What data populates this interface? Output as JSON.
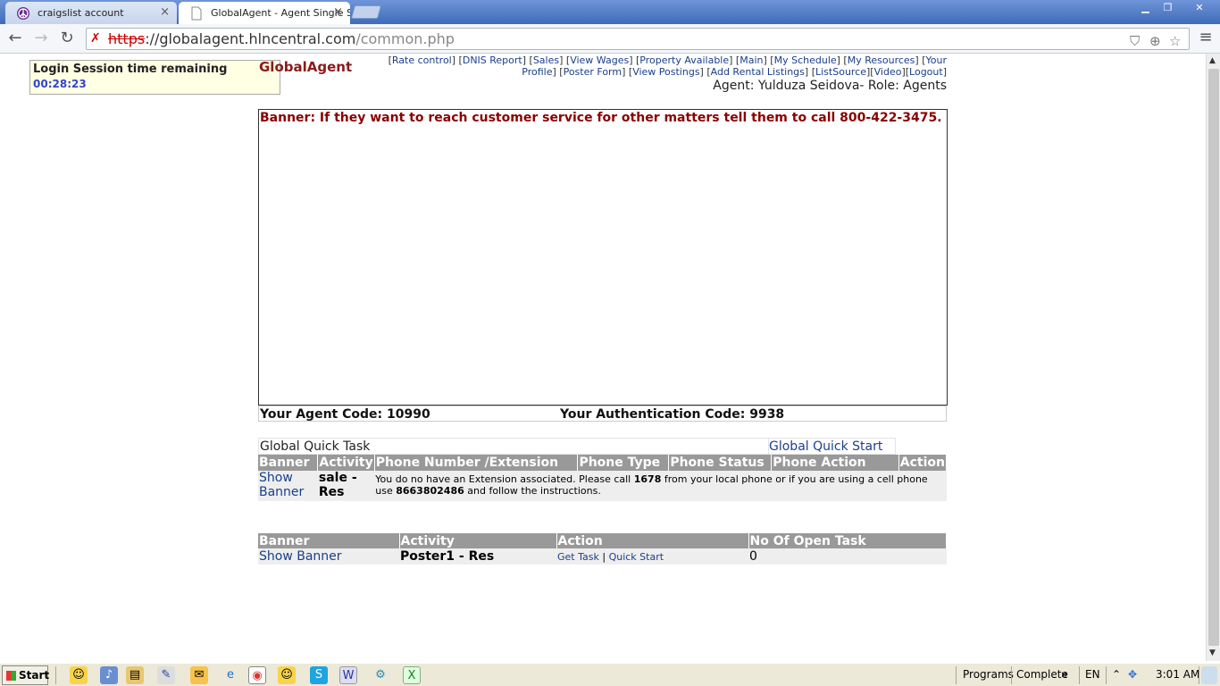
{
  "browser": {
    "tabs": [
      {
        "title": "craigslist account",
        "active": false
      },
      {
        "title": "GlobalAgent - Agent Single S",
        "active": true
      }
    ],
    "address": {
      "scheme": "https",
      "host": "://globalagent.hlncentral.com",
      "path": "/common.php"
    }
  },
  "session": {
    "label": "Login Session time remaining",
    "time": "00:28:23"
  },
  "header": {
    "logo": "GlobalAgent",
    "nav_line1": [
      "Rate control",
      "DNIS Report",
      "Sales",
      "View Wages",
      "Property Available",
      "Main",
      "My Schedule",
      "My Resources",
      "Your"
    ],
    "nav_line2": [
      "Profile",
      "Poster Form",
      "View Postings",
      "Add Rental Listings",
      "ListSource",
      "Video",
      "Logout"
    ],
    "agent_line": "Agent: Yulduza Seidova- Role: Agents"
  },
  "banner": {
    "text": "Banner: If they want to reach customer service for other matters tell them to call 800-422-3475."
  },
  "codes": {
    "agent_code": "Your Agent Code: 10990",
    "auth_code": "Your Authentication Code: 9938"
  },
  "quick_task": {
    "title": "Global Quick Task",
    "quick_start_link": "Global Quick Start",
    "headers": [
      "Banner",
      "Activity",
      "Phone Number /Extension",
      "Phone Type",
      "Phone Status",
      "Phone Action",
      "Action"
    ],
    "row": {
      "banner_link_1": "Show",
      "banner_link_2": "Banner",
      "activity_1": "sale -",
      "activity_2": "Res",
      "msg_part1": "You do no have an Extension associated. Please call ",
      "msg_num1": "1678",
      "msg_part2": " from your local phone or if you are using a cell phone use ",
      "msg_num2": "8663802486",
      "msg_part3": " and follow the instructions."
    }
  },
  "open_tasks": {
    "headers": [
      "Banner",
      "Activity",
      "Action",
      "No Of Open Task"
    ],
    "row": {
      "banner_link": "Show Banner",
      "activity": "Poster1 - Res",
      "get_task": "Get Task",
      "sep": "|",
      "quick_start": "Quick Start",
      "count": "0"
    }
  },
  "taskbar": {
    "start": "Start",
    "programs": "Programs",
    "complete": "Complete",
    "lang": "EN",
    "clock": "3:01 AM"
  }
}
